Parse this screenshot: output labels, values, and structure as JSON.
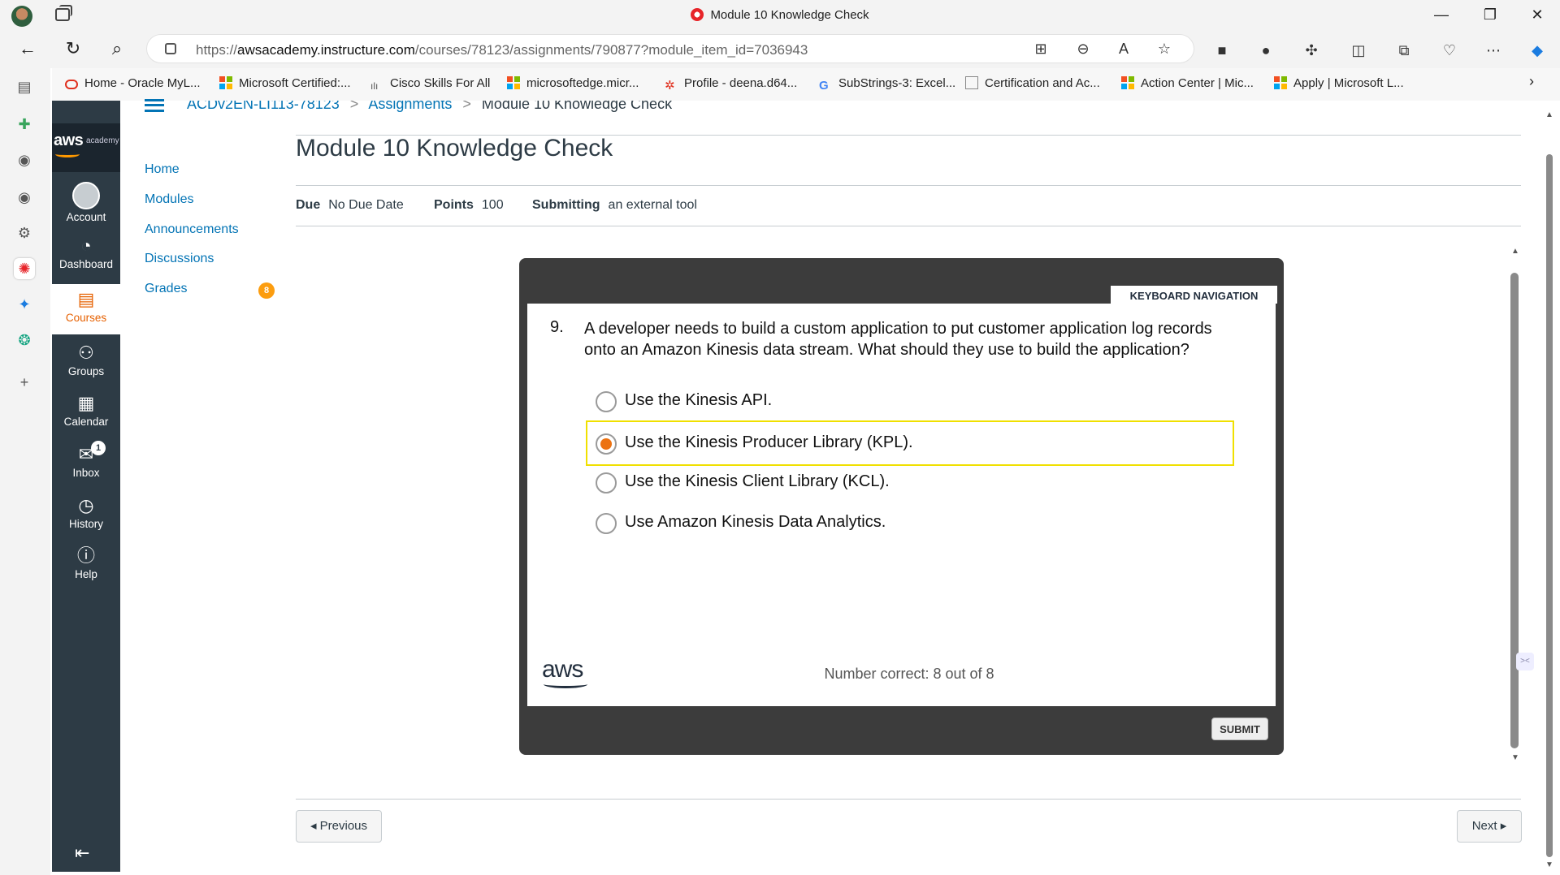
{
  "browser": {
    "window_title": "Module 10 Knowledge Check",
    "url_prefix": "https://",
    "url_host": "awsacademy.instructure.com",
    "url_path": "/courses/78123/assignments/790877?module_item_id=7036943"
  },
  "favorites": [
    "Home - Oracle MyL...",
    "Microsoft Certified:...",
    "Cisco Skills For All",
    "microsoftedge.micr...",
    "Profile - deena.d64...",
    "SubStrings-3: Excel...",
    "Certification and Ac...",
    "Action Center | Mic...",
    "Apply | Microsoft L..."
  ],
  "global_nav": {
    "logo_text": "aws",
    "logo_sub": "academy",
    "items": [
      "Account",
      "Dashboard",
      "Courses",
      "Groups",
      "Calendar",
      "Inbox",
      "History",
      "Help"
    ],
    "inbox_badge": "1"
  },
  "breadcrumb": {
    "course": "ACDv2EN-LI113-78123",
    "section": "Assignments",
    "current": "Module 10 Knowledge Check",
    "sep": ">"
  },
  "course_nav": {
    "items": [
      "Home",
      "Modules",
      "Announcements",
      "Discussions",
      "Grades"
    ],
    "grades_badge": "8"
  },
  "assignment": {
    "title": "Module 10 Knowledge Check",
    "due_label": "Due",
    "due_value": "No Due Date",
    "points_label": "Points",
    "points_value": "100",
    "submitting_label": "Submitting",
    "submitting_value": "an external tool"
  },
  "quiz": {
    "keyboard_nav": "KEYBOARD NAVIGATION",
    "question_number": "9.",
    "question_text": "A developer needs to build a custom application to put customer application log records onto an Amazon Kinesis data stream. What should they use to build the application?",
    "options": [
      {
        "text": "Use the Kinesis API.",
        "selected": false
      },
      {
        "text": "Use the Kinesis Producer Library (KPL).",
        "selected": true
      },
      {
        "text": "Use the Kinesis Client Library (KCL).",
        "selected": false
      },
      {
        "text": "Use Amazon Kinesis Data Analytics.",
        "selected": false
      }
    ],
    "logo": "aws",
    "score": "Number correct: 8 out of 8",
    "submit_label": "SUBMIT",
    "accent_color": "#ec7211",
    "highlight_color": "#f0e000"
  },
  "pager": {
    "previous": "◂ Previous",
    "next": "Next ▸"
  }
}
